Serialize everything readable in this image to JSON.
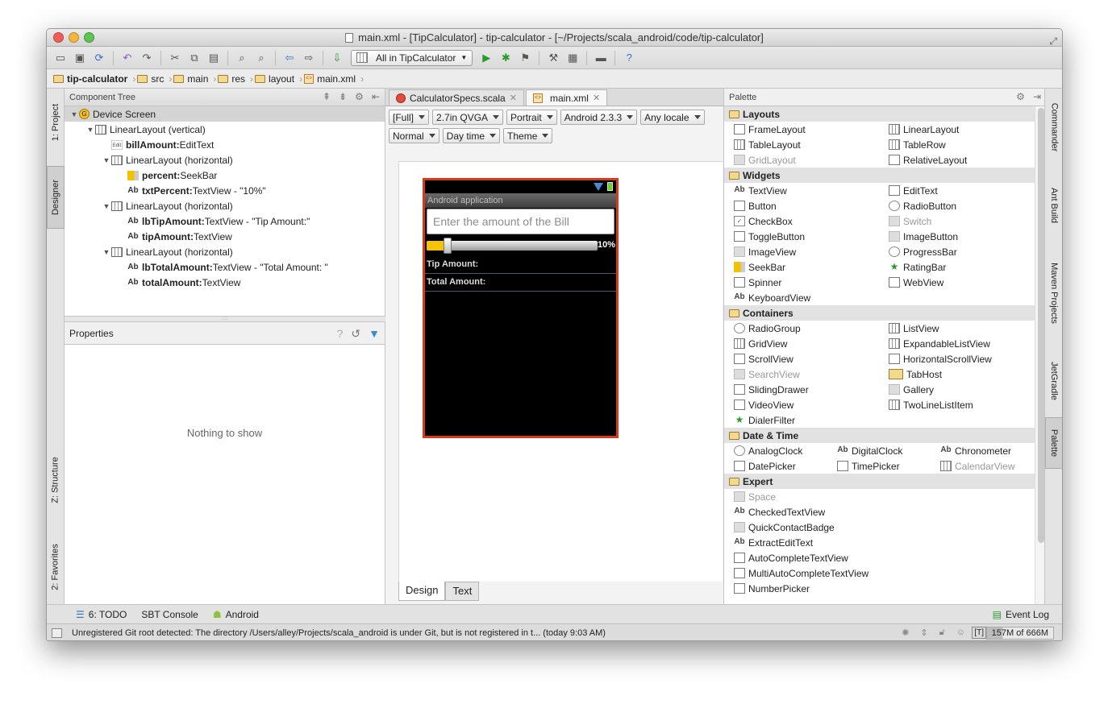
{
  "window": {
    "title": "main.xml - [TipCalculator] - tip-calculator - [~/Projects/scala_android/code/tip-calculator]"
  },
  "toolbar": {
    "run_config": "All in TipCalculator"
  },
  "breadcrumbs": [
    "tip-calculator",
    "src",
    "main",
    "res",
    "layout",
    "main.xml"
  ],
  "left_tabs": [
    "1: Project",
    "Designer",
    "Z: Structure",
    "2: Favorites"
  ],
  "right_tabs": [
    "Commander",
    "Ant Build",
    "Maven Projects",
    "JetGradle",
    "Palette"
  ],
  "component_tree": {
    "header": "Component Tree",
    "nodes": [
      {
        "label": "Device Screen",
        "bold": "",
        "rest": "Device Screen"
      },
      {
        "label": "LinearLayout (vertical)"
      },
      {
        "bold": "billAmount:",
        "rest": " EditText"
      },
      {
        "label": "LinearLayout (horizontal)"
      },
      {
        "bold": "percent:",
        "rest": " SeekBar"
      },
      {
        "bold": "txtPercent:",
        "rest": " TextView - \"10%\""
      },
      {
        "label": "LinearLayout (horizontal)"
      },
      {
        "bold": "lbTipAmount:",
        "rest": " TextView - \"Tip Amount:\""
      },
      {
        "bold": "tipAmount:",
        "rest": " TextView"
      },
      {
        "label": "LinearLayout (horizontal)"
      },
      {
        "bold": "lbTotalAmount:",
        "rest": " TextView - \"Total Amount: \""
      },
      {
        "bold": "totalAmount:",
        "rest": " TextView"
      }
    ]
  },
  "properties": {
    "header": "Properties",
    "empty": "Nothing to show"
  },
  "editor": {
    "tabs": [
      {
        "label": "CalculatorSpecs.scala"
      },
      {
        "label": "main.xml"
      }
    ],
    "options": [
      "[Full]",
      "2.7in QVGA",
      "Portrait",
      "Android 2.3.3",
      "Any locale",
      "Normal",
      "Day time",
      "Theme"
    ],
    "mode_tabs": [
      "Design",
      "Text"
    ]
  },
  "phone": {
    "app_title": "Android application",
    "bill_hint": "Enter the amount of the Bill",
    "percent": "10%",
    "seek_fraction": 0.1,
    "tip_label": "Tip Amount:",
    "total_label": "Total Amount:"
  },
  "palette": {
    "header": "Palette",
    "groups": [
      {
        "name": "Layouts",
        "items": [
          "FrameLayout",
          "LinearLayout",
          "TableLayout",
          "TableRow",
          "GridLayout",
          "RelativeLayout"
        ]
      },
      {
        "name": "Widgets",
        "items": [
          "TextView",
          "EditText",
          "Button",
          "RadioButton",
          "CheckBox",
          "Switch",
          "ToggleButton",
          "ImageButton",
          "ImageView",
          "ProgressBar",
          "SeekBar",
          "RatingBar",
          "Spinner",
          "WebView",
          "KeyboardView"
        ]
      },
      {
        "name": "Containers",
        "items": [
          "RadioGroup",
          "ListView",
          "GridView",
          "ExpandableListView",
          "ScrollView",
          "HorizontalScrollView",
          "SearchView",
          "TabHost",
          "SlidingDrawer",
          "Gallery",
          "VideoView",
          "TwoLineListItem",
          "DialerFilter"
        ]
      },
      {
        "name": "Date & Time",
        "items": [
          "AnalogClock",
          "DigitalClock",
          "Chronometer",
          "DatePicker",
          "TimePicker",
          "CalendarView"
        ]
      },
      {
        "name": "Expert",
        "items": [
          "Space",
          "CheckedTextView",
          "QuickContactBadge",
          "ExtractEditText",
          "AutoCompleteTextView",
          "MultiAutoCompleteTextView",
          "NumberPicker"
        ]
      }
    ]
  },
  "bottom_tabs": [
    "6: TODO",
    "SBT Console",
    "Android"
  ],
  "event_log": "Event Log",
  "status": {
    "message": "Unregistered Git root detected: The directory /Users/alley/Projects/scala_android is under Git, but is not registered in t... (today 9:03 AM)",
    "git": "[T]",
    "memory": "157M of 666M"
  }
}
